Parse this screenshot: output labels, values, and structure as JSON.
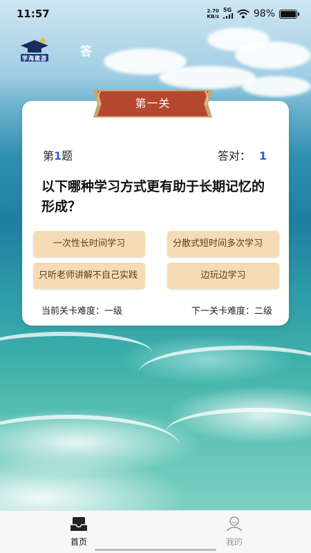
{
  "status_bar": {
    "time": "11:57",
    "speed_value": "2.70",
    "speed_unit": "KB/s",
    "network": "5G",
    "battery": "98%",
    "battery_level": 0.98
  },
  "header": {
    "logo_text": "学海遨游",
    "title": "答"
  },
  "card": {
    "stage_title": "第一关",
    "question_prefix": "第",
    "question_number": "1",
    "question_suffix": "题",
    "correct_label": "答对：",
    "correct_count": "1",
    "question_text": "以下哪种学习方式更有助于长期记忆的形成？",
    "options": [
      "一次性长时间学习",
      "分散式短时间多次学习",
      "只听老师讲解不自己实践",
      "边玩边学习"
    ],
    "current_level": "当前关卡难度：一级",
    "next_level": "下一关卡难度：二级"
  },
  "nav": {
    "home": "首页",
    "mine": "我的",
    "active": "home"
  },
  "colors": {
    "accent_blue": "#2b61c9",
    "option_bg": "#f6dcb6",
    "ribbon": "#b5472e"
  }
}
